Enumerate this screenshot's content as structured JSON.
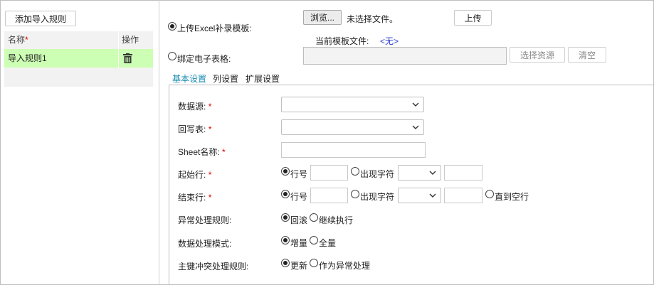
{
  "left": {
    "add_rule_button": "添加导入规则",
    "table": {
      "col_name": "名称",
      "col_action": "操作",
      "rows": [
        {
          "name": "导入规则1"
        }
      ]
    }
  },
  "source": {
    "upload_option_label": "上传Excel补录模板:",
    "browse_button": "浏览...",
    "no_file_text": "未选择文件。",
    "upload_button": "上传",
    "current_template_label": "当前模板文件:",
    "current_template_value": "<无>",
    "bind_option_label": "绑定电子表格:",
    "select_resource_button": "选择资源",
    "clear_button": "清空"
  },
  "tabs": [
    "基本设置",
    "列设置",
    "扩展设置"
  ],
  "form": {
    "datasource_label": "数据源:",
    "writeback_label": "回写表:",
    "sheet_label": "Sheet名称:",
    "start_row_label": "起始行:",
    "end_row_label": "结束行:",
    "row_number_option": "行号",
    "appear_char_option": "出现字符",
    "until_empty_option": "直到空行",
    "exception_label": "异常处理规则:",
    "rollback_option": "回滚",
    "continue_option": "继续执行",
    "mode_label": "数据处理模式:",
    "increment_option": "增量",
    "full_option": "全量",
    "pk_conflict_label": "主键冲突处理规则:",
    "update_option": "更新",
    "as_exception_option": "作为异常处理"
  }
}
